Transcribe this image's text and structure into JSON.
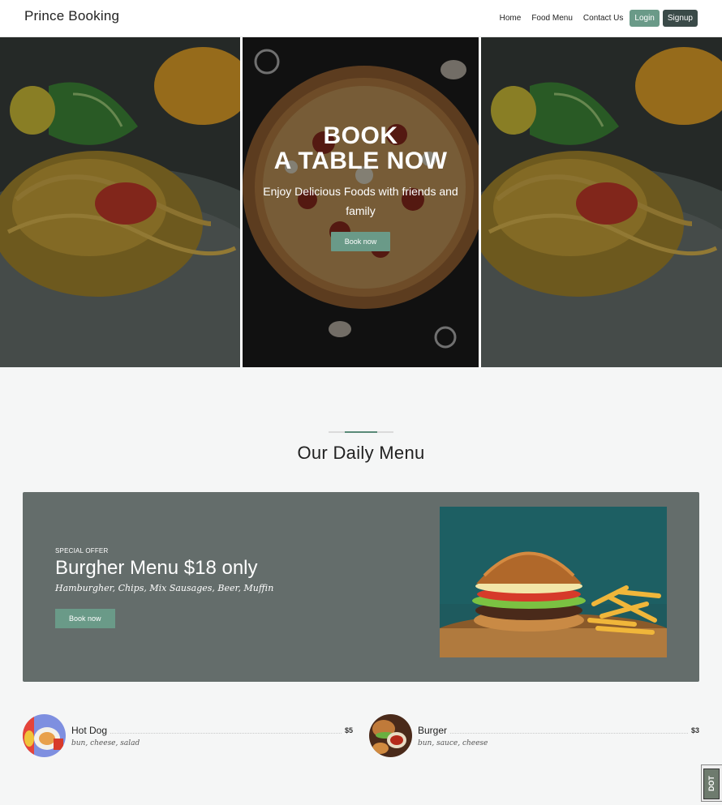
{
  "navbar": {
    "brand": "Prince Booking",
    "links": [
      "Home",
      "Food Menu",
      "Contact Us"
    ],
    "login": "Login",
    "signup": "Signup"
  },
  "hero": {
    "title_line1": "BOOK",
    "title_line2": "A TABLE NOW",
    "subtitle": "Enjoy Delicious Foods with friends and family",
    "button": "Book now"
  },
  "menu": {
    "title": "Our Daily Menu",
    "offer": {
      "kicker": "SPECIAL OFFER",
      "title": "Burgher Menu $18 only",
      "items": "Hamburgher, Chips, Mix Sausages, Beer, Muffin",
      "button": "Book now"
    },
    "items": [
      {
        "name": "Hot Dog",
        "price": "$5",
        "desc": "bun, cheese, salad"
      },
      {
        "name": "Burger",
        "price": "$3",
        "desc": "bun, sauce, cheese"
      }
    ]
  },
  "badge": "DOT",
  "colors": {
    "accent": "#6a9a88",
    "signup": "#3a4a48",
    "offer_bg": "#646d6b",
    "page_bg": "#f5f6f6"
  }
}
